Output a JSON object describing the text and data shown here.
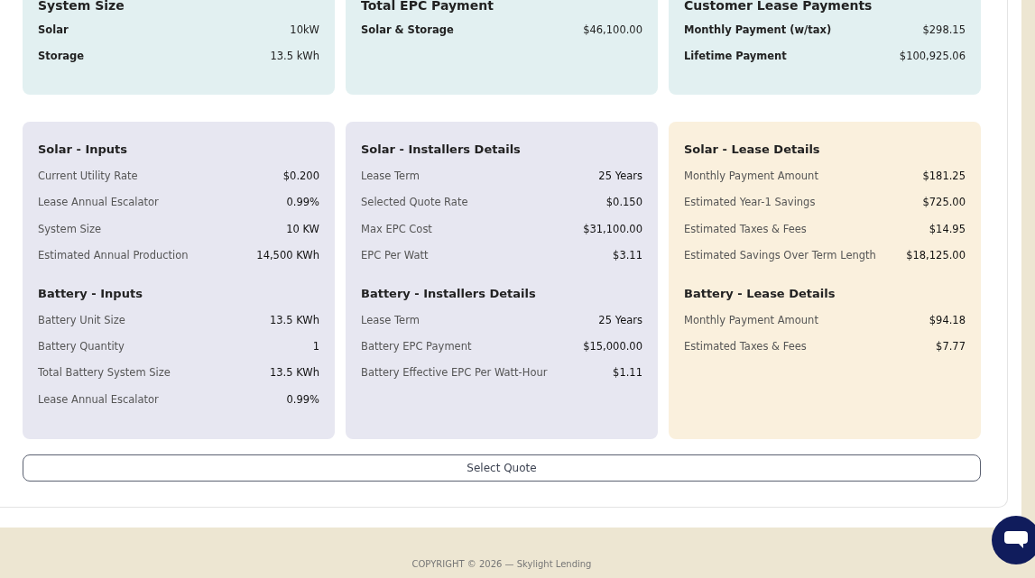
{
  "summary_cards": [
    {
      "title": "System Size",
      "rows": [
        {
          "label": "Solar",
          "value": "10kW"
        },
        {
          "label": "Storage",
          "value": "13.5 kWh"
        }
      ]
    },
    {
      "title": "Total EPC Payment",
      "rows": [
        {
          "label": "Solar & Storage",
          "value": "$46,100.00"
        }
      ]
    },
    {
      "title": "Customer Lease Payments",
      "rows": [
        {
          "label": "Monthly Payment (w/tax)",
          "value": "$298.15"
        },
        {
          "label": "Lifetime Payment",
          "value": "$100,925.06"
        }
      ]
    }
  ],
  "detail_panels": [
    {
      "kind": "inputs",
      "sections": [
        {
          "title": "Solar - Inputs",
          "rows": [
            {
              "label": "Current Utility Rate",
              "value": "$0.200"
            },
            {
              "label": "Lease Annual Escalator",
              "value": "0.99%"
            },
            {
              "label": "System Size",
              "value": "10 KW"
            },
            {
              "label": "Estimated Annual Production",
              "value": "14,500 KWh"
            }
          ]
        },
        {
          "title": "Battery - Inputs",
          "rows": [
            {
              "label": "Battery Unit Size",
              "value": "13.5 KWh"
            },
            {
              "label": "Battery Quantity",
              "value": "1"
            },
            {
              "label": "Total Battery System Size",
              "value": "13.5 KWh"
            },
            {
              "label": "Lease Annual Escalator",
              "value": "0.99%"
            }
          ]
        }
      ]
    },
    {
      "kind": "installer",
      "sections": [
        {
          "title": "Solar - Installers Details",
          "rows": [
            {
              "label": "Lease Term",
              "value": "25 Years"
            },
            {
              "label": "Selected Quote Rate",
              "value": "$0.150"
            },
            {
              "label": "Max EPC Cost",
              "value": "$31,100.00"
            },
            {
              "label": "EPC Per Watt",
              "value": "$3.11"
            }
          ]
        },
        {
          "title": "Battery - Installers Details",
          "rows": [
            {
              "label": "Lease Term",
              "value": "25 Years"
            },
            {
              "label": "Battery EPC Payment",
              "value": "$15,000.00"
            },
            {
              "label": "Battery Effective EPC Per Watt-Hour",
              "value": "$1.11"
            }
          ]
        }
      ]
    },
    {
      "kind": "lease",
      "sections": [
        {
          "title": "Solar - Lease Details",
          "rows": [
            {
              "label": "Monthly Payment Amount",
              "value": "$181.25"
            },
            {
              "label": "Estimated Year-1 Savings",
              "value": "$725.00"
            },
            {
              "label": "Estimated Taxes & Fees",
              "value": "$14.95"
            },
            {
              "label": "Estimated Savings Over Term Length",
              "value": "$18,125.00"
            }
          ]
        },
        {
          "title": "Battery - Lease Details",
          "rows": [
            {
              "label": "Monthly Payment Amount",
              "value": "$94.18"
            },
            {
              "label": "Estimated Taxes & Fees",
              "value": "$7.77"
            }
          ]
        }
      ]
    }
  ],
  "select_button": {
    "label": "Select Quote"
  },
  "footer": {
    "copyright": "COPYRIGHT © 2026 — Skylight Lending"
  }
}
